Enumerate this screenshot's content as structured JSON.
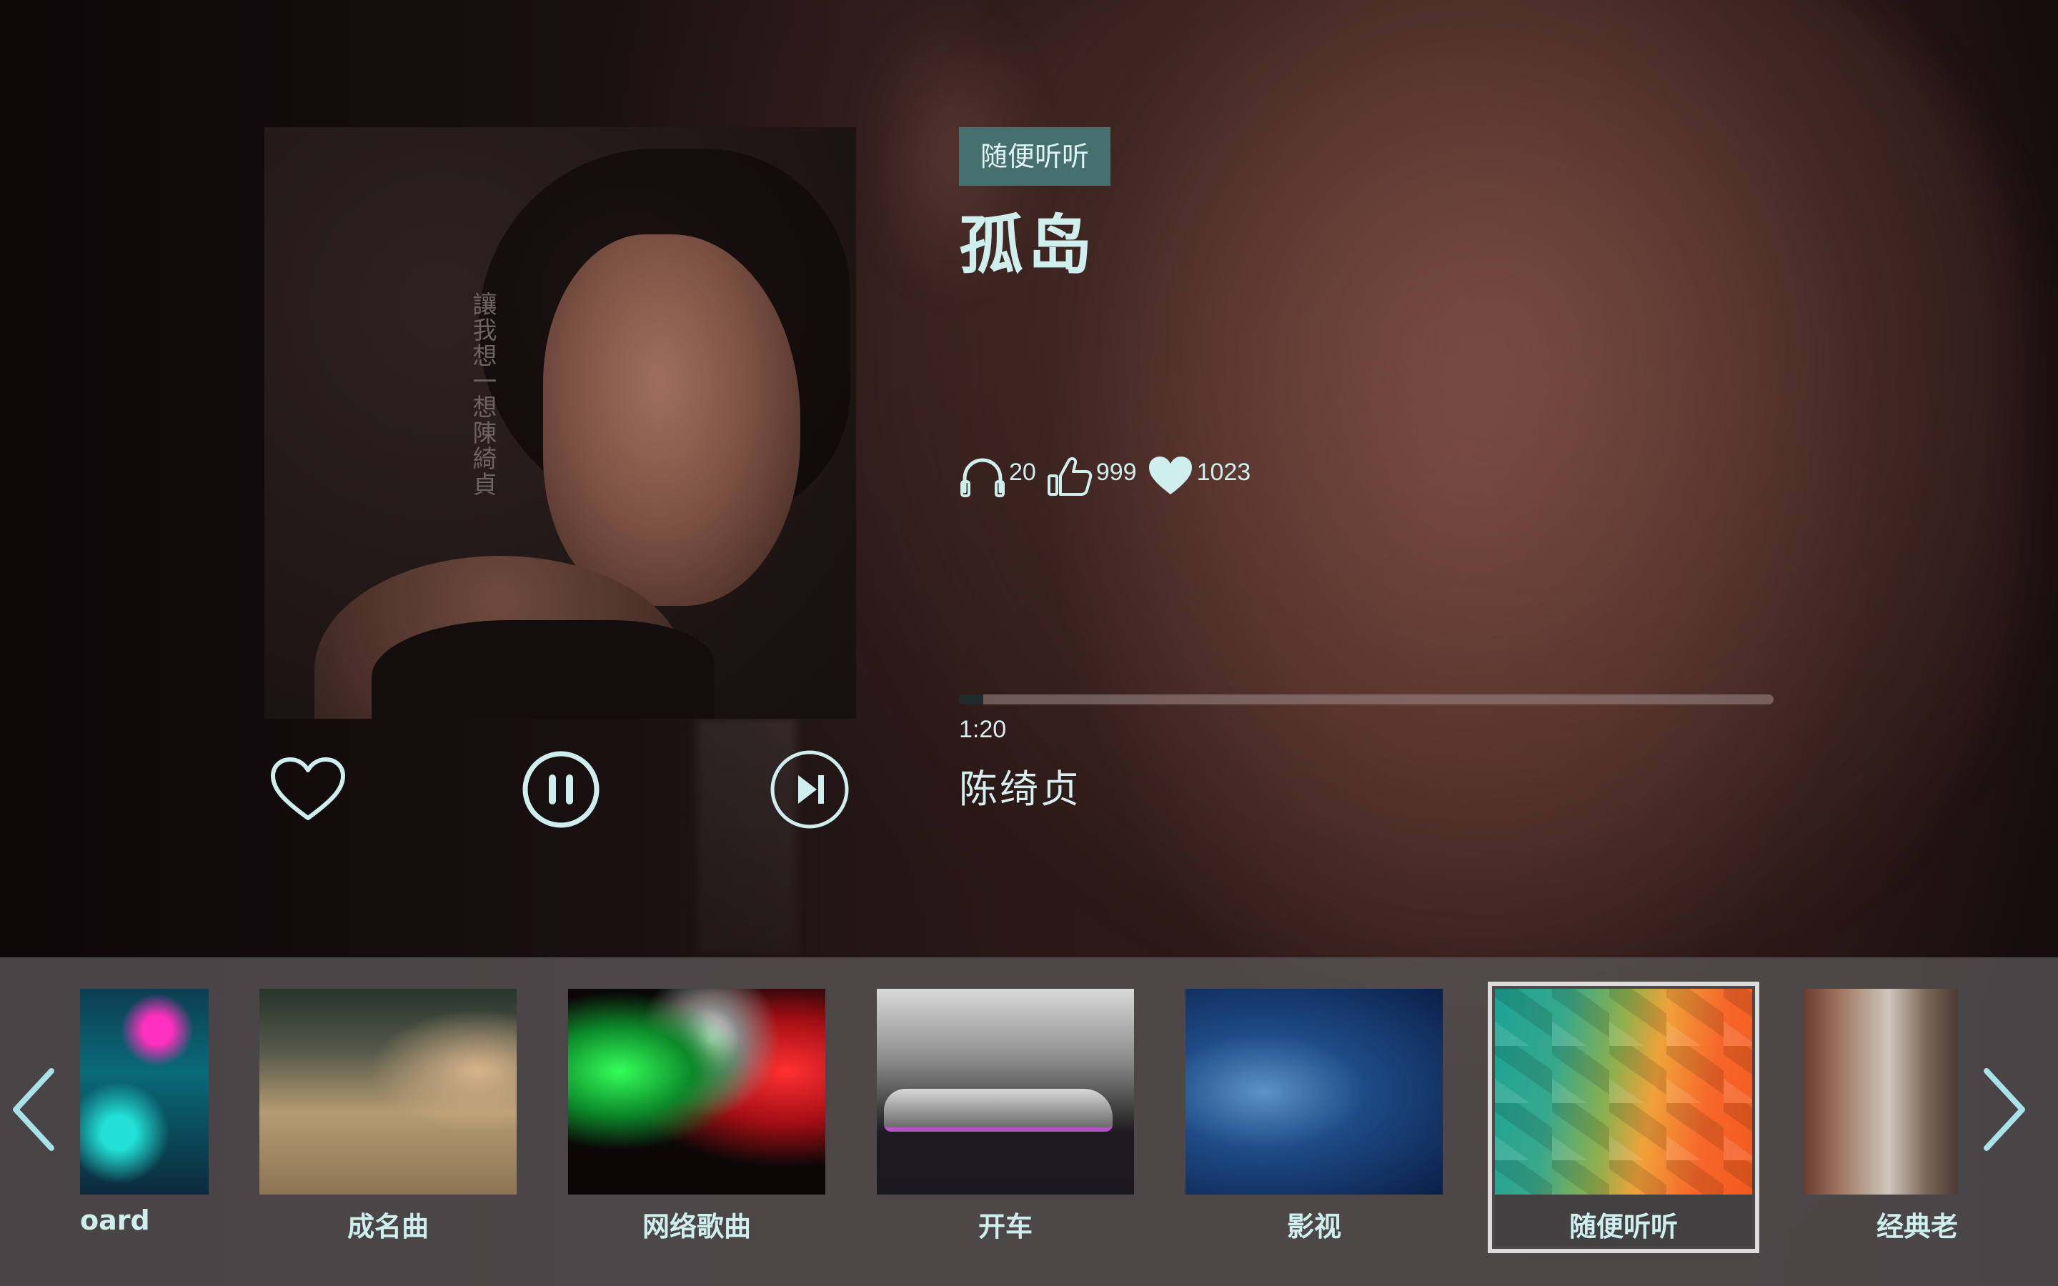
{
  "player": {
    "tag": "随便听听",
    "title": "孤岛",
    "artist": "陈绮贞",
    "time": "1:20",
    "progress_fraction": 0.03,
    "album_art_text": "讓我想一想陳綺貞",
    "stats": {
      "listens": "20",
      "thumbs_up": "999",
      "hearts": "1023"
    }
  },
  "controls": {
    "like_icon": "heart-outline-icon",
    "pause_icon": "pause-circle-icon",
    "next_icon": "skip-next-circle-icon"
  },
  "carousel": {
    "items": [
      {
        "label": "oard",
        "selected": false
      },
      {
        "label": "成名曲",
        "selected": false
      },
      {
        "label": "网络歌曲",
        "selected": false
      },
      {
        "label": "开车",
        "selected": false
      },
      {
        "label": "影视",
        "selected": false
      },
      {
        "label": "随便听听",
        "selected": true
      },
      {
        "label": "经典老",
        "selected": false
      }
    ],
    "prev_icon": "chevron-left-icon",
    "next_icon": "chevron-right-icon"
  },
  "colors": {
    "accent": "#cfeeee",
    "tag_bg": "#46706f",
    "progress_track": "#9f8c8a",
    "progress_fill": "#1f2a2c"
  }
}
